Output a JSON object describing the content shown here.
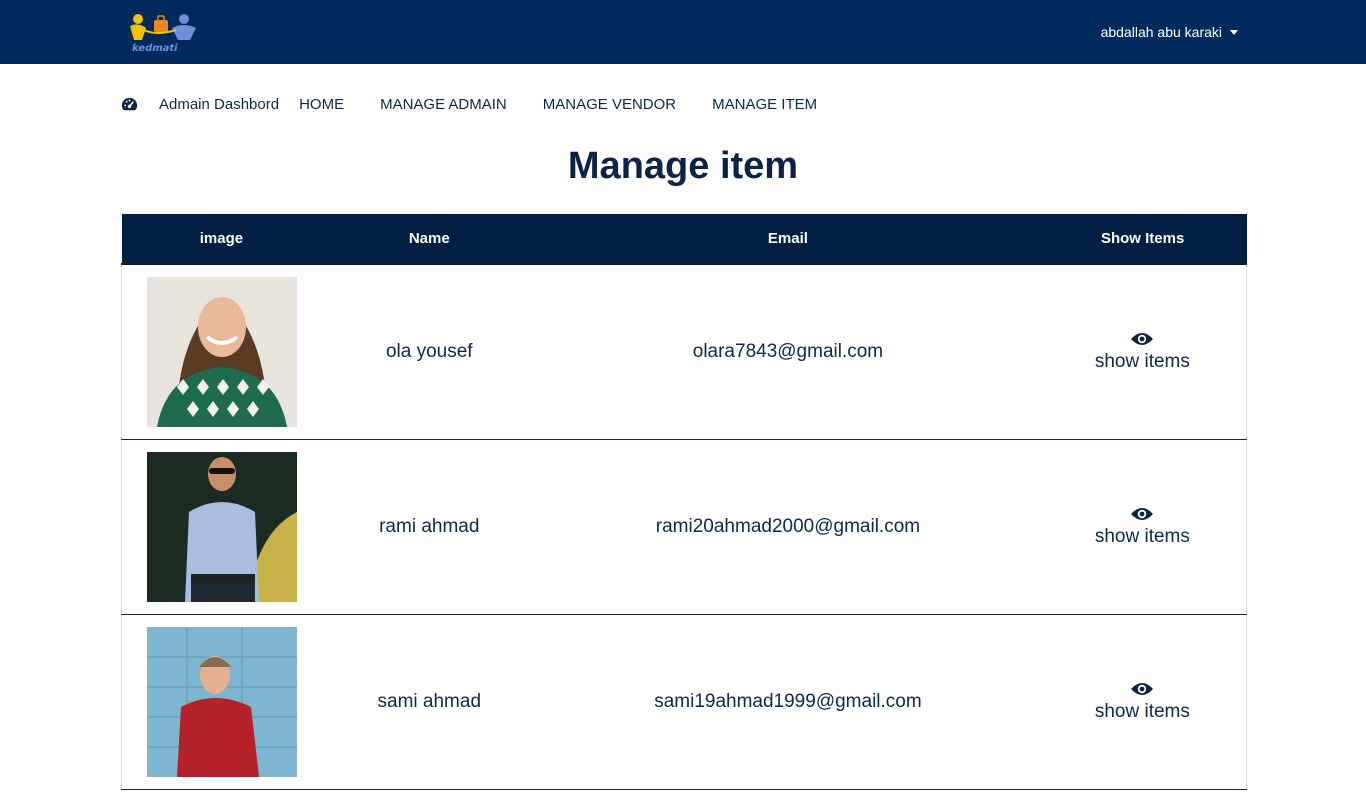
{
  "header": {
    "user_name": "abdallah abu karaki",
    "brand_color": "#012a5c"
  },
  "nav": {
    "dashboard_icon": "dashboard-gauge-icon",
    "brand_label": "Admain Dashbord",
    "links": [
      {
        "label": "HOME"
      },
      {
        "label": "MANAGE ADMAIN"
      },
      {
        "label": "MANAGE VENDOR"
      },
      {
        "label": "MANAGE ITEM"
      }
    ]
  },
  "page": {
    "title": "Manage item"
  },
  "table": {
    "headers": {
      "image": "image",
      "name": "Name",
      "email": "Email",
      "show": "Show Items"
    },
    "rows": [
      {
        "name": "ola yousef",
        "email": "olara7843@gmail.com",
        "action_label": "show items",
        "action_icon": "eye-icon"
      },
      {
        "name": "rami ahmad",
        "email": "rami20ahmad2000@gmail.com",
        "action_label": "show items",
        "action_icon": "eye-icon"
      },
      {
        "name": "sami ahmad",
        "email": "sami19ahmad1999@gmail.com",
        "action_label": "show items",
        "action_icon": "eye-icon"
      }
    ]
  }
}
